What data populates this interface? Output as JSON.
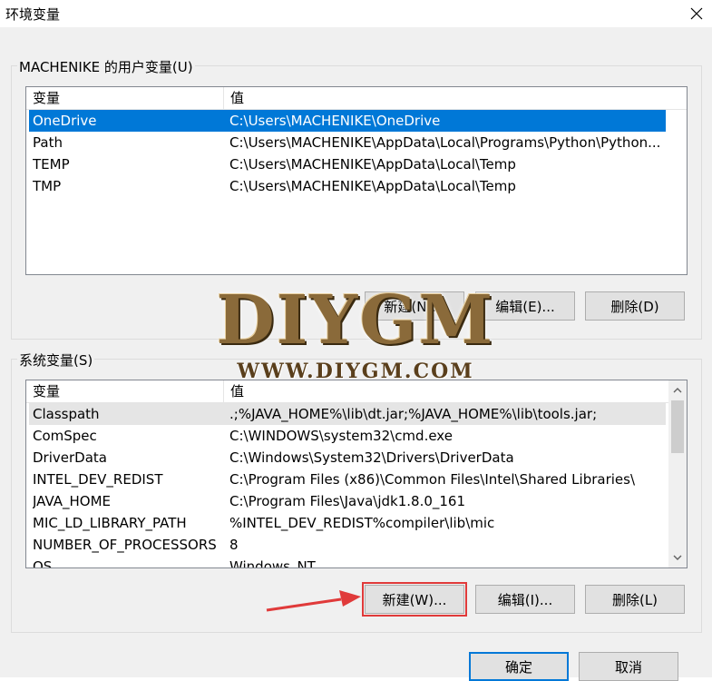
{
  "window": {
    "title": "环境变量"
  },
  "user_vars": {
    "group_label": "MACHENIKE 的用户变量(U)",
    "columns": [
      "变量",
      "值"
    ],
    "rows": [
      {
        "name": "OneDrive",
        "value": "C:\\Users\\MACHENIKE\\OneDrive",
        "selected": true
      },
      {
        "name": "Path",
        "value": "C:\\Users\\MACHENIKE\\AppData\\Local\\Programs\\Python\\Python..."
      },
      {
        "name": "TEMP",
        "value": "C:\\Users\\MACHENIKE\\AppData\\Local\\Temp"
      },
      {
        "name": "TMP",
        "value": "C:\\Users\\MACHENIKE\\AppData\\Local\\Temp"
      }
    ],
    "buttons": {
      "new": "新建(N)...",
      "edit": "编辑(E)...",
      "delete": "删除(D)"
    }
  },
  "system_vars": {
    "group_label": "系统变量(S)",
    "columns": [
      "变量",
      "值"
    ],
    "rows": [
      {
        "name": "Classpath",
        "value": ".;%JAVA_HOME%\\lib\\dt.jar;%JAVA_HOME%\\lib\\tools.jar;"
      },
      {
        "name": "ComSpec",
        "value": "C:\\WINDOWS\\system32\\cmd.exe"
      },
      {
        "name": "DriverData",
        "value": "C:\\Windows\\System32\\Drivers\\DriverData"
      },
      {
        "name": "INTEL_DEV_REDIST",
        "value": "C:\\Program Files (x86)\\Common Files\\Intel\\Shared Libraries\\"
      },
      {
        "name": "JAVA_HOME",
        "value": "C:\\Program Files\\Java\\jdk1.8.0_161"
      },
      {
        "name": "MIC_LD_LIBRARY_PATH",
        "value": "%INTEL_DEV_REDIST%compiler\\lib\\mic"
      },
      {
        "name": "NUMBER_OF_PROCESSORS",
        "value": "8"
      },
      {
        "name": "OS",
        "value": "Windows_NT"
      }
    ],
    "buttons": {
      "new": "新建(W)...",
      "edit": "编辑(I)...",
      "delete": "删除(L)"
    }
  },
  "footer": {
    "ok": "确定",
    "cancel": "取消"
  },
  "watermark": {
    "logo": "DIYGM",
    "url": "WWW.DIYGM.COM"
  },
  "colors": {
    "selection": "#0078d7",
    "annotation": "#e03a3a"
  }
}
